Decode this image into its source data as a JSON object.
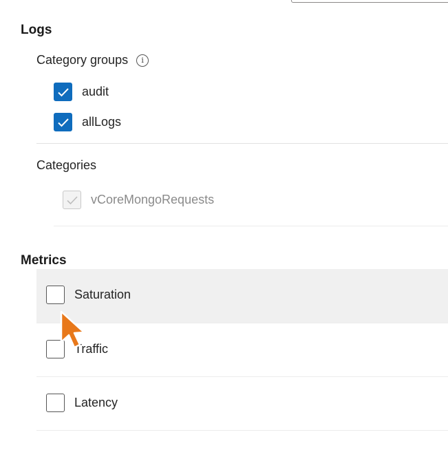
{
  "logs": {
    "title": "Logs",
    "category_groups": {
      "label": "Category groups",
      "info_icon": "info-icon",
      "items": [
        {
          "label": "audit",
          "checked": true
        },
        {
          "label": "allLogs",
          "checked": true
        }
      ]
    },
    "categories": {
      "label": "Categories",
      "items": [
        {
          "label": "vCoreMongoRequests",
          "checked": true,
          "disabled": true
        }
      ]
    }
  },
  "metrics": {
    "title": "Metrics",
    "items": [
      {
        "label": "Saturation",
        "checked": false,
        "hovered": true
      },
      {
        "label": "Traffic",
        "checked": false
      },
      {
        "label": "Latency",
        "checked": false
      }
    ]
  },
  "colors": {
    "accent": "#0f6cbd",
    "hover_row": "#f0f0f0",
    "cursor": "#e8781a"
  },
  "icons": [
    "info-icon",
    "checkmark-icon",
    "mouse-pointer-icon"
  ]
}
